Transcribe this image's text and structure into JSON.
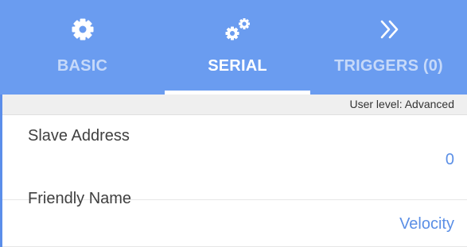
{
  "tabs": [
    {
      "label": "BASIC",
      "icon": "gear-icon",
      "state": "inactive"
    },
    {
      "label": "SERIAL",
      "icon": "gears-icon",
      "state": "active"
    },
    {
      "label": "TRIGGERS (0)",
      "icon": "double-chevron-right-icon",
      "state": "inactive"
    }
  ],
  "user_level": "User level: Advanced",
  "settings": [
    {
      "name": "Slave Address",
      "value": "0"
    },
    {
      "name": "Friendly Name",
      "value": "Velocity"
    }
  ],
  "colors": {
    "tabbar_background": "#6a9cf0",
    "value_text": "#5b8fe6",
    "strip_background": "#efefef"
  }
}
